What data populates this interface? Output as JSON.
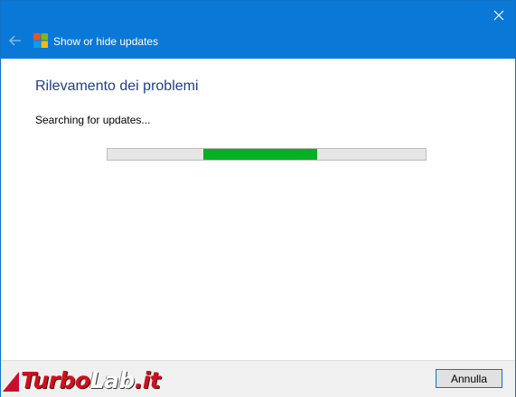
{
  "window": {
    "title": "Show or hide updates",
    "close_icon": "close-icon",
    "back_icon": "back-arrow-icon",
    "app_icon": "windows-logo-icon"
  },
  "content": {
    "heading": "Rilevamento dei problemi",
    "status": "Searching for updates...",
    "progress": {
      "indeterminate": true,
      "segment_start_fraction": 0.3,
      "segment_end_fraction": 0.66
    }
  },
  "footer": {
    "cancel_label": "Annulla"
  },
  "watermark": {
    "part1": "Turbo",
    "part2": "Lab",
    "part3": ".it"
  },
  "colors": {
    "titlebar": "#0a78d7",
    "heading": "#1d3f8f",
    "progress_fill": "#06b025",
    "progress_track": "#e6e6e6"
  }
}
